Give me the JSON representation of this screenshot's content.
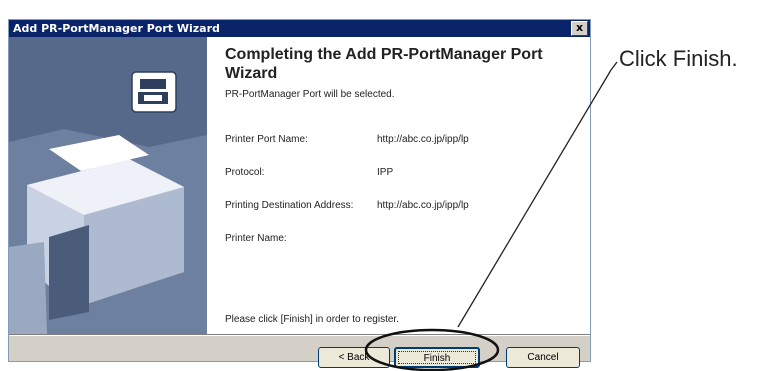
{
  "window": {
    "title": "Add PR-PortManager Port Wizard",
    "close_label": "x"
  },
  "wizard": {
    "heading": "Completing the Add PR-PortManager Port Wizard",
    "subtext": "PR-PortManager Port will be selected.",
    "fields": [
      {
        "label": "Printer Port Name:",
        "value": "http://abc.co.jp/ipp/lp"
      },
      {
        "label": "Protocol:",
        "value": "IPP"
      },
      {
        "label": "Printing Destination Address:",
        "value": "http://abc.co.jp/ipp/lp"
      },
      {
        "label": "Printer Name:",
        "value": ""
      }
    ],
    "footnote": "Please click [Finish] in order to register."
  },
  "buttons": {
    "back": "< Back",
    "finish": "Finish",
    "cancel": "Cancel"
  },
  "annotation": {
    "text": "Click Finish."
  }
}
